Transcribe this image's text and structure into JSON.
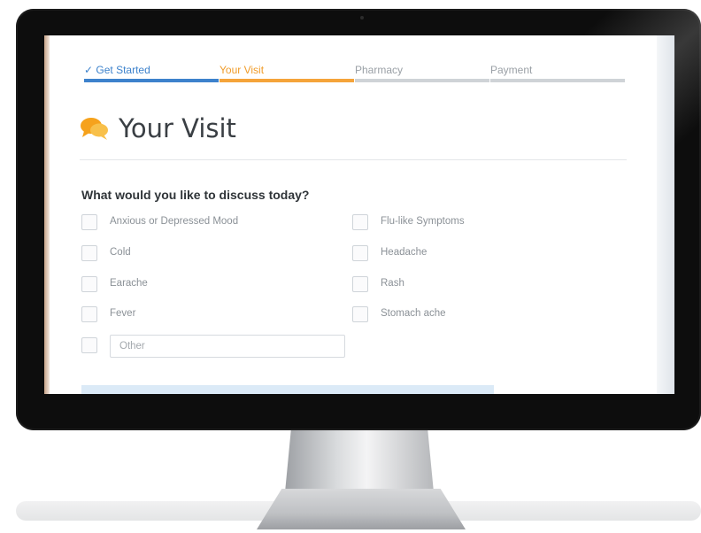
{
  "steps": [
    {
      "label": "✓ Get Started",
      "state": "complete",
      "color": "#3d82cc"
    },
    {
      "label": "Your Visit",
      "state": "current",
      "color": "#f09c2a"
    },
    {
      "label": "Pharmacy",
      "state": "upcoming",
      "color": "#9aa0a6"
    },
    {
      "label": "Payment",
      "state": "upcoming",
      "color": "#9aa0a6"
    }
  ],
  "page": {
    "title": "Your Visit",
    "title_icon": "chat-bubbles-icon",
    "question": "What would you like to discuss today?"
  },
  "options": {
    "left": [
      "Anxious or Depressed Mood",
      "Cold",
      "Earache",
      "Fever"
    ],
    "right": [
      "Flu-like Symptoms",
      "Headache",
      "Rash",
      "Stomach ache"
    ],
    "other_placeholder": "Other"
  },
  "colors": {
    "accent_blue": "#3d82cc",
    "accent_orange": "#f5a43a",
    "bezel": "#0d0d0d"
  }
}
